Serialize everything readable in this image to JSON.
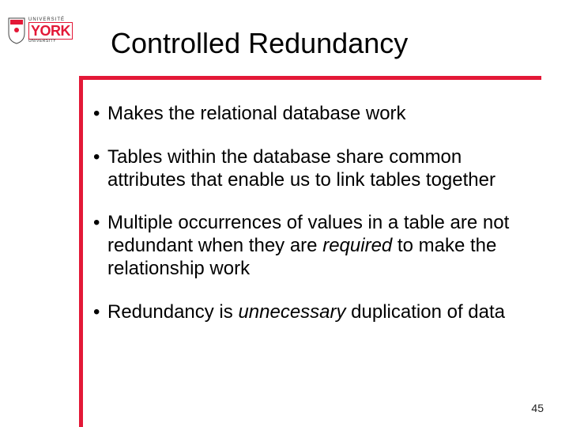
{
  "logo": {
    "top_text": "UNIVERSITÉ",
    "main": "YORK",
    "bottom_text": "UNIVERSITY"
  },
  "title": "Controlled Redundancy",
  "bullets": [
    {
      "pre": "Makes the relational database work",
      "em": "",
      "post": ""
    },
    {
      "pre": "Tables within the database share common attributes that enable us to link tables together",
      "em": "",
      "post": ""
    },
    {
      "pre": "Multiple occurrences of values in a table are not redundant when they are ",
      "em": "required",
      "post": " to make the relationship work"
    },
    {
      "pre": "Redundancy is ",
      "em": "unnecessary",
      "post": " duplication of data"
    }
  ],
  "page_number": "45",
  "colors": {
    "accent": "#e31837"
  }
}
